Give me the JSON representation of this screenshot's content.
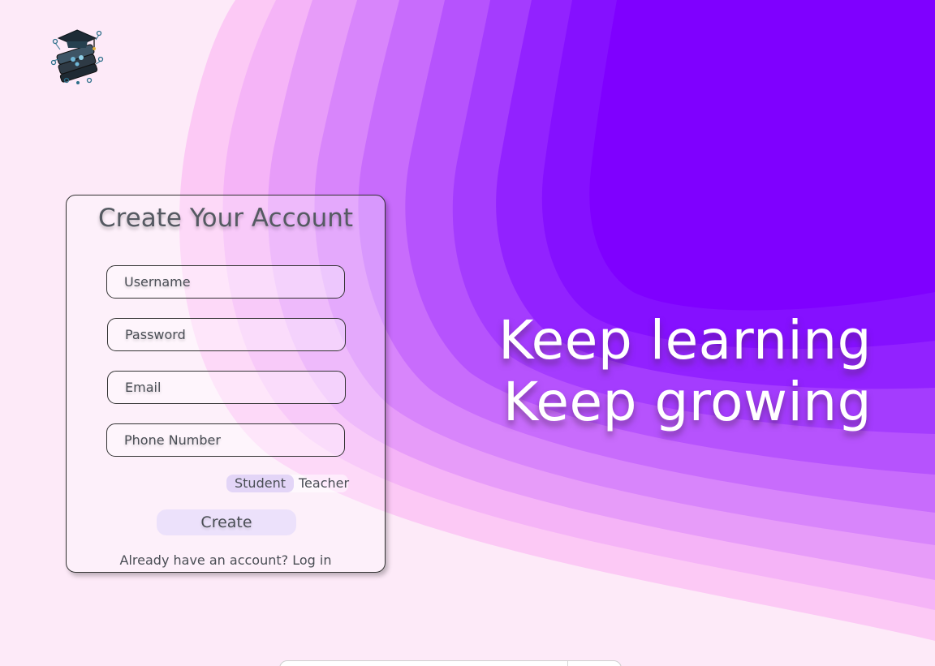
{
  "brand": {
    "logo_icon": "graduation-cap-tech-icon"
  },
  "tagline": {
    "line1": "Keep learning",
    "line2": "Keep growing"
  },
  "form": {
    "title": "Create Your Account",
    "fields": {
      "username_placeholder": "Username",
      "password_placeholder": "Password",
      "email_placeholder": "Email",
      "phone_placeholder": "Phone Number"
    },
    "role": {
      "options": [
        "Student",
        "Teacher"
      ],
      "selected": "Student"
    },
    "submit_label": "Create",
    "login_prompt": "Already have an account? Log in"
  },
  "colors": {
    "background_light": "#fdeaf8",
    "accent_purple": "#7f00ff",
    "toggle_active": "#e3d5f7",
    "button_bg": "#ece1fb"
  }
}
